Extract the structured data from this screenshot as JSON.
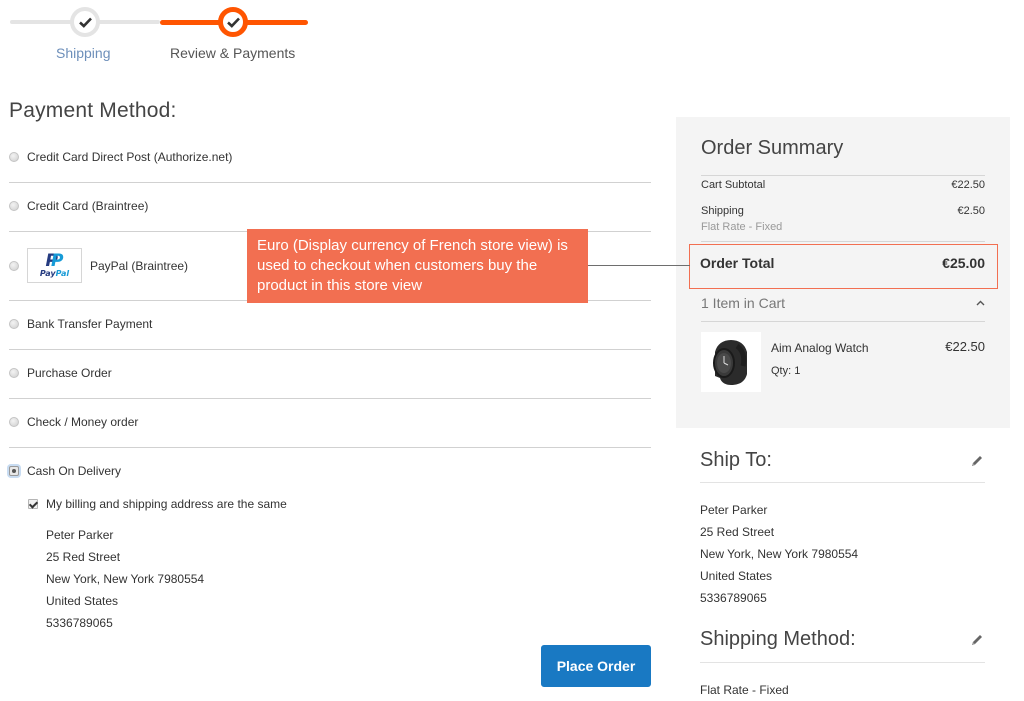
{
  "progress": {
    "steps": [
      {
        "label": "Shipping",
        "state": "done"
      },
      {
        "label": "Review & Payments",
        "state": "active"
      }
    ],
    "colors": {
      "active": "#ff5501",
      "inactive": "#e4e4e4",
      "done_label": "#6d8fba"
    }
  },
  "payment": {
    "title": "Payment Method:",
    "methods": [
      {
        "label": "Credit Card Direct Post (Authorize.net)",
        "selected": false
      },
      {
        "label": "Credit Card (Braintree)",
        "selected": false
      },
      {
        "label": "PayPal (Braintree)",
        "selected": false,
        "logo": "paypal-logo",
        "logo_text_pay": "Pay",
        "logo_text_pal": "Pal"
      },
      {
        "label": "Bank Transfer Payment",
        "selected": false
      },
      {
        "label": "Purchase Order",
        "selected": false
      },
      {
        "label": "Check / Money order",
        "selected": false
      },
      {
        "label": "Cash On Delivery",
        "selected": true
      }
    ],
    "billing_same": {
      "label": "My billing and shipping address are the same",
      "checked": true
    },
    "billing_address": [
      "Peter Parker",
      "25 Red Street",
      "New York, New York 7980554",
      "United States",
      "5336789065"
    ],
    "place_order_label": "Place Order",
    "accent": "#1979c3"
  },
  "callout": {
    "text": "Euro (Display currency of French store view) is used to checkout when customers buy the product in this store view",
    "color": "#f26f51"
  },
  "summary": {
    "title": "Order Summary",
    "cart_subtotal_label": "Cart Subtotal",
    "cart_subtotal_value": "€22.50",
    "shipping_label": "Shipping",
    "shipping_value": "€2.50",
    "shipping_method": "Flat Rate - Fixed",
    "order_total_label": "Order Total",
    "order_total_value": "€25.00",
    "items_in_cart": "1 Item in Cart",
    "items": [
      {
        "name": "Aim Analog Watch",
        "qty": "Qty: 1",
        "price": "€22.50",
        "image": "watch-image"
      }
    ]
  },
  "ship_to": {
    "title": "Ship To:",
    "address": [
      "Peter Parker",
      "25 Red Street",
      "New York, New York 7980554",
      "United States",
      "5336789065"
    ]
  },
  "shipping_method": {
    "title": "Shipping Method:",
    "value": "Flat Rate - Fixed"
  }
}
